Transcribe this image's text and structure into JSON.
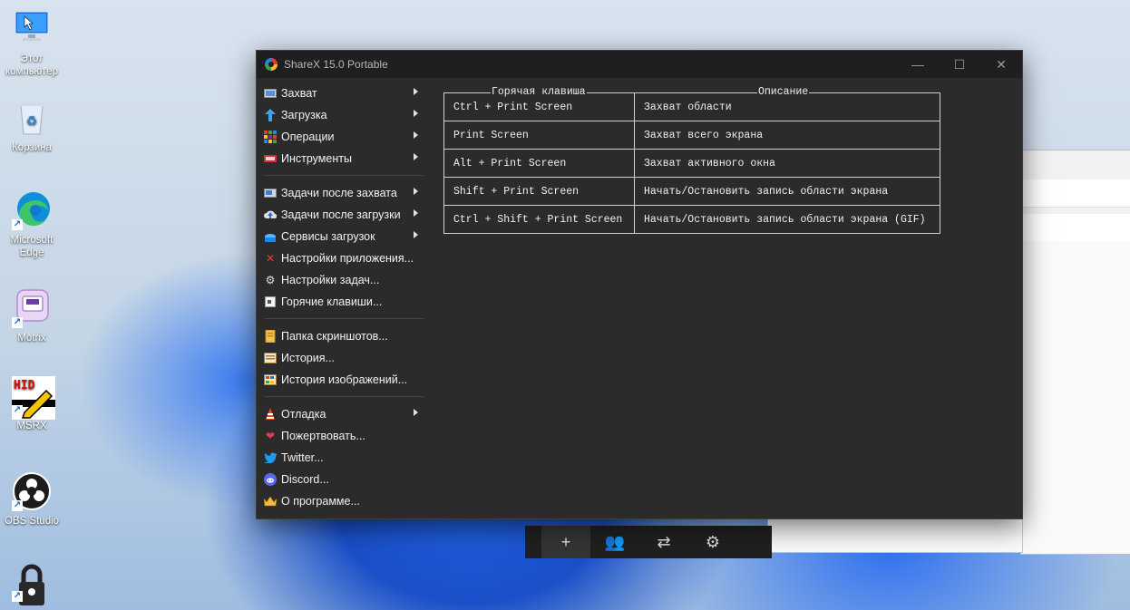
{
  "desktop": {
    "icons": [
      {
        "label": "Этот компьютер",
        "icon": "this-pc-icon"
      },
      {
        "label": "Корзина",
        "icon": "recycle-bin-icon"
      },
      {
        "label": "Microsoft Edge",
        "icon": "edge-icon"
      },
      {
        "label": "Motrix",
        "icon": "motrix-icon"
      },
      {
        "label": "MSRX",
        "icon": "msrx-icon",
        "badge": "HID"
      },
      {
        "label": "OBS Studio",
        "icon": "obs-icon"
      },
      {
        "label": "",
        "icon": "lock-icon"
      }
    ]
  },
  "window": {
    "title": "ShareX 15.0 Portable",
    "controls": [
      "—",
      "☐",
      "✕"
    ]
  },
  "menu": {
    "items": [
      {
        "label": "Захват",
        "icon": "capture-icon",
        "submenu": true
      },
      {
        "label": "Загрузка",
        "icon": "upload-icon",
        "submenu": true
      },
      {
        "label": "Операции",
        "icon": "workflows-icon",
        "submenu": true
      },
      {
        "label": "Инструменты",
        "icon": "tools-icon",
        "submenu": true
      },
      {
        "label": "Задачи после захвата",
        "icon": "after-capture-icon",
        "submenu": true
      },
      {
        "label": "Задачи после загрузки",
        "icon": "after-upload-icon",
        "submenu": true
      },
      {
        "label": "Сервисы загрузок",
        "icon": "destinations-icon",
        "submenu": true
      },
      {
        "label": "Настройки приложения...",
        "icon": "app-settings-icon",
        "submenu": false
      },
      {
        "label": "Настройки задач...",
        "icon": "task-settings-icon",
        "submenu": false
      },
      {
        "label": "Горячие клавиши...",
        "icon": "hotkeys-icon",
        "submenu": false
      },
      {
        "label": "Папка скриншотов...",
        "icon": "screenshots-folder-icon",
        "submenu": false
      },
      {
        "label": "История...",
        "icon": "history-icon",
        "submenu": false
      },
      {
        "label": "История изображений...",
        "icon": "image-history-icon",
        "submenu": false
      },
      {
        "label": "Отладка",
        "icon": "debug-icon",
        "submenu": true
      },
      {
        "label": "Пожертвовать...",
        "icon": "donate-icon",
        "submenu": false
      },
      {
        "label": "Twitter...",
        "icon": "twitter-icon",
        "submenu": false
      },
      {
        "label": "Discord...",
        "icon": "discord-icon",
        "submenu": false
      },
      {
        "label": "О программе...",
        "icon": "about-icon",
        "submenu": false
      }
    ]
  },
  "hotkeys": {
    "col_key": "Горячая клавиша",
    "col_desc": "Описание",
    "rows": [
      {
        "key": "Ctrl + Print Screen",
        "desc": "Захват области"
      },
      {
        "key": "Print Screen",
        "desc": "Захват всего экрана"
      },
      {
        "key": "Alt + Print Screen",
        "desc": "Захват активного окна"
      },
      {
        "key": "Shift + Print Screen",
        "desc": "Начать/Остановить запись области экрана"
      },
      {
        "key": "Ctrl + Shift + Print Screen",
        "desc": "Начать/Остановить запись области экрана (GIF)"
      }
    ]
  },
  "toolbar": {
    "buttons": [
      "plus-icon",
      "people-icon",
      "swap-icon",
      "gear-icon"
    ]
  }
}
